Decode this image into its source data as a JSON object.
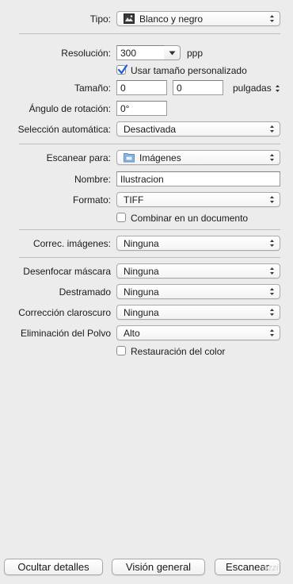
{
  "tipo": {
    "label": "Tipo:",
    "value": "Blanco y negro",
    "icon": "scanner-photo-icon"
  },
  "resolucion": {
    "label": "Resolución:",
    "value": "300",
    "unit": "ppp"
  },
  "usar_tamano": {
    "label": "Usar tamaño personalizado",
    "checked": true
  },
  "tamano": {
    "label": "Tamaño:",
    "width": "0",
    "height": "0",
    "unit": "pulgadas"
  },
  "angulo": {
    "label": "Ángulo de rotación:",
    "value": "0°"
  },
  "seleccion": {
    "label": "Selección automática:",
    "value": "Desactivada"
  },
  "escanear_para": {
    "label": "Escanear para:",
    "value": "Imágenes",
    "icon": "folder-icon"
  },
  "nombre": {
    "label": "Nombre:",
    "value": "Ilustracion"
  },
  "formato": {
    "label": "Formato:",
    "value": "TIFF"
  },
  "combinar": {
    "label": "Combinar en un documento",
    "checked": false
  },
  "correc": {
    "label": "Correc. imágenes:",
    "value": "Ninguna"
  },
  "desenfocar": {
    "label": "Desenfocar máscara",
    "value": "Ninguna"
  },
  "destramado": {
    "label": "Destramado",
    "value": "Ninguna"
  },
  "claroscuro": {
    "label": "Corrección claroscuro",
    "value": "Ninguna"
  },
  "polvo": {
    "label": "Eliminación del Polvo",
    "value": "Alto"
  },
  "restauracion": {
    "label": "Restauración del color",
    "checked": false
  },
  "buttons": {
    "ocultar": "Ocultar detalles",
    "vision": "Visión general",
    "escanear": "Escanear"
  },
  "watermark": "ozzi",
  "colors": {
    "background": "#ececec",
    "check_blue": "#1f5fd6"
  }
}
